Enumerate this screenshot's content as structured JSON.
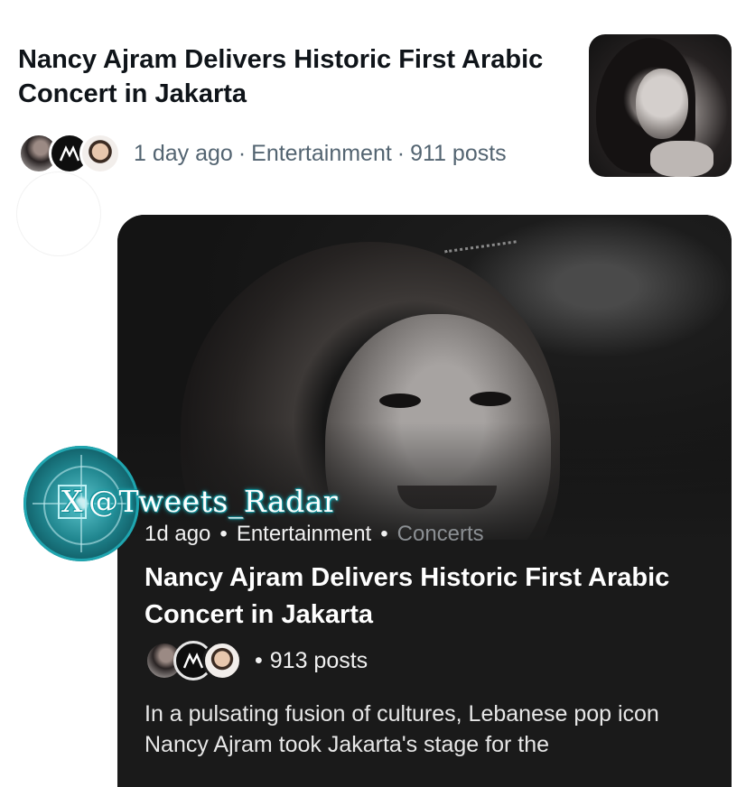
{
  "news_item": {
    "title": "Nancy Ajram Delivers Historic First Arabic Concert in Jakarta",
    "time_ago": "1 day ago",
    "category": "Entertainment",
    "posts": "911 posts",
    "separator": "·"
  },
  "card": {
    "time_ago": "1d ago",
    "category": "Entertainment",
    "subcategory": "Concerts",
    "bullet": "•",
    "title": "Nancy Ajram Delivers Historic First Arabic Concert in Jakarta",
    "posts": "913 posts",
    "description": "In a pulsating fusion of cultures, Lebanese pop icon Nancy Ajram took Jakarta's stage for the"
  },
  "watermark": {
    "text": "@Tweets_Radar",
    "x_glyph": "X"
  },
  "colors": {
    "secondary_text": "#536471",
    "card_background": "#1a1a1a",
    "muted_tag": "#8b8f93",
    "watermark_glow": "#1aa9b3"
  }
}
